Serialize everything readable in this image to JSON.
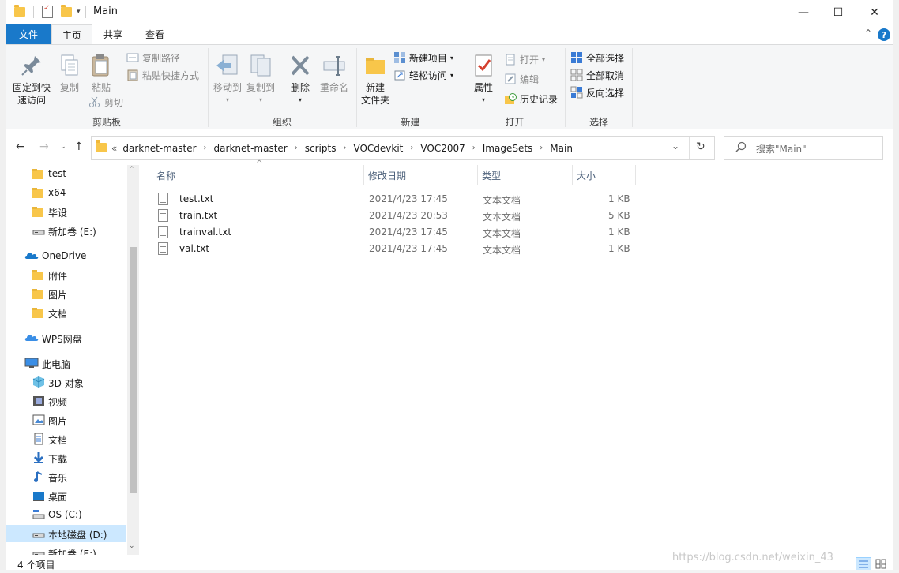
{
  "window": {
    "title": "Main",
    "controls": {
      "minimize": "—",
      "maximize": "☐",
      "close": "✕"
    }
  },
  "ribbon": {
    "tabs": [
      "文件",
      "主页",
      "共享",
      "查看"
    ],
    "active_tab": "主页",
    "help": "?",
    "groups": {
      "clipboard": {
        "label": "剪贴板",
        "pin_line1": "固定到快",
        "pin_line2": "速访问",
        "copy": "复制",
        "paste": "粘贴",
        "copy_path": "复制路径",
        "paste_shortcut": "粘贴快捷方式",
        "cut": "剪切"
      },
      "organize": {
        "label": "组织",
        "move_to": "移动到",
        "copy_to": "复制到",
        "delete": "删除",
        "rename": "重命名"
      },
      "new": {
        "label": "新建",
        "new_folder_line1": "新建",
        "new_folder_line2": "文件夹",
        "new_item": "新建项目",
        "easy_access": "轻松访问"
      },
      "open": {
        "label": "打开",
        "properties": "属性",
        "open": "打开",
        "edit": "编辑",
        "history": "历史记录"
      },
      "select": {
        "label": "选择",
        "select_all": "全部选择",
        "select_none": "全部取消",
        "invert": "反向选择"
      }
    }
  },
  "address": {
    "overflow": "«",
    "crumbs": [
      "darknet-master",
      "darknet-master",
      "scripts",
      "VOCdevkit",
      "VOC2007",
      "ImageSets",
      "Main"
    ],
    "search_placeholder": "搜索\"Main\""
  },
  "nav_pane": {
    "items": [
      {
        "label": "test",
        "icon": "folder-icon",
        "indent": 1
      },
      {
        "label": "x64",
        "icon": "folder-icon",
        "indent": 1
      },
      {
        "label": "毕设",
        "icon": "folder-icon",
        "indent": 1
      },
      {
        "label": "新加卷 (E:)",
        "icon": "drive-icon",
        "indent": 1
      },
      {
        "label": "OneDrive",
        "icon": "onedrive-icon",
        "indent": 0
      },
      {
        "label": "附件",
        "icon": "folder-icon",
        "indent": 1
      },
      {
        "label": "图片",
        "icon": "folder-icon",
        "indent": 1
      },
      {
        "label": "文档",
        "icon": "folder-icon",
        "indent": 1
      },
      {
        "label": "WPS网盘",
        "icon": "cloud-icon",
        "indent": 0
      },
      {
        "label": "此电脑",
        "icon": "computer-icon",
        "indent": 0
      },
      {
        "label": "3D 对象",
        "icon": "3d-objects-icon",
        "indent": 1
      },
      {
        "label": "视频",
        "icon": "video-icon",
        "indent": 1
      },
      {
        "label": "图片",
        "icon": "pictures-icon",
        "indent": 1
      },
      {
        "label": "文档",
        "icon": "documents-icon",
        "indent": 1
      },
      {
        "label": "下载",
        "icon": "download-icon",
        "indent": 1
      },
      {
        "label": "音乐",
        "icon": "music-icon",
        "indent": 1
      },
      {
        "label": "桌面",
        "icon": "desktop-icon",
        "indent": 1
      },
      {
        "label": "OS (C:)",
        "icon": "os-drive-icon",
        "indent": 1
      },
      {
        "label": "本地磁盘 (D:)",
        "icon": "drive-icon",
        "indent": 1,
        "selected": true
      },
      {
        "label": "新加卷 (E:)",
        "icon": "drive-icon",
        "indent": 1
      }
    ]
  },
  "file_list": {
    "columns": [
      "名称",
      "修改日期",
      "类型",
      "大小"
    ],
    "rows": [
      {
        "name": "test.txt",
        "modified": "2021/4/23 17:45",
        "type": "文本文档",
        "size": "1 KB"
      },
      {
        "name": "train.txt",
        "modified": "2021/4/23 20:53",
        "type": "文本文档",
        "size": "5 KB"
      },
      {
        "name": "trainval.txt",
        "modified": "2021/4/23 17:45",
        "type": "文本文档",
        "size": "1 KB"
      },
      {
        "name": "val.txt",
        "modified": "2021/4/23 17:45",
        "type": "文本文档",
        "size": "1 KB"
      }
    ]
  },
  "status": {
    "count": "4 个项目"
  },
  "watermark": "https://blog.csdn.net/weixin_43",
  "colors": {
    "accent": "#1979ca",
    "selected": "#cce8ff",
    "folder": "#f8c64a"
  }
}
